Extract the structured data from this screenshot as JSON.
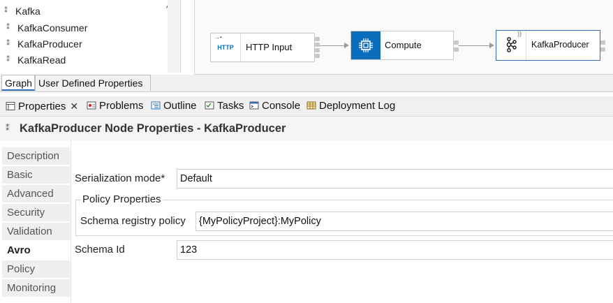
{
  "palette": {
    "items": [
      {
        "label": "Kafka"
      },
      {
        "label": "KafkaConsumer"
      },
      {
        "label": "KafkaProducer"
      },
      {
        "label": "KafkaRead"
      }
    ]
  },
  "flow": {
    "nodes": [
      {
        "label": "HTTP Input",
        "icon_text": "HTTP",
        "icon": "http-input-icon"
      },
      {
        "label": "Compute",
        "icon": "chip-icon"
      },
      {
        "label": "KafkaProducer",
        "icon": "kafka-icon"
      }
    ]
  },
  "editor_tabs": [
    {
      "label": "Graph"
    },
    {
      "label": "User Defined Properties"
    }
  ],
  "view_tabs": [
    {
      "label": "Properties",
      "icon": "properties-icon"
    },
    {
      "label": "Problems",
      "icon": "problems-icon"
    },
    {
      "label": "Outline",
      "icon": "outline-icon"
    },
    {
      "label": "Tasks",
      "icon": "tasks-icon"
    },
    {
      "label": "Console",
      "icon": "console-icon"
    },
    {
      "label": "Deployment Log",
      "icon": "deployment-log-icon"
    }
  ],
  "properties": {
    "title": "KafkaProducer Node Properties - KafkaProducer",
    "categories": [
      {
        "label": "Description"
      },
      {
        "label": "Basic"
      },
      {
        "label": "Advanced"
      },
      {
        "label": "Security"
      },
      {
        "label": "Validation"
      },
      {
        "label": "Avro"
      },
      {
        "label": "Policy"
      },
      {
        "label": "Monitoring"
      }
    ],
    "active_category": "Avro",
    "serialization_mode": {
      "label": "Serialization mode*",
      "value": "Default"
    },
    "policy_group": {
      "title": "Policy Properties"
    },
    "schema_registry_policy": {
      "label": "Schema registry policy",
      "value": "{MyPolicyProject}:MyPolicy"
    },
    "schema_id": {
      "label": "Schema Id",
      "value": "123"
    }
  },
  "colors": {
    "accent": "#0a6ebd",
    "selection_border": "#2d6bb3"
  }
}
